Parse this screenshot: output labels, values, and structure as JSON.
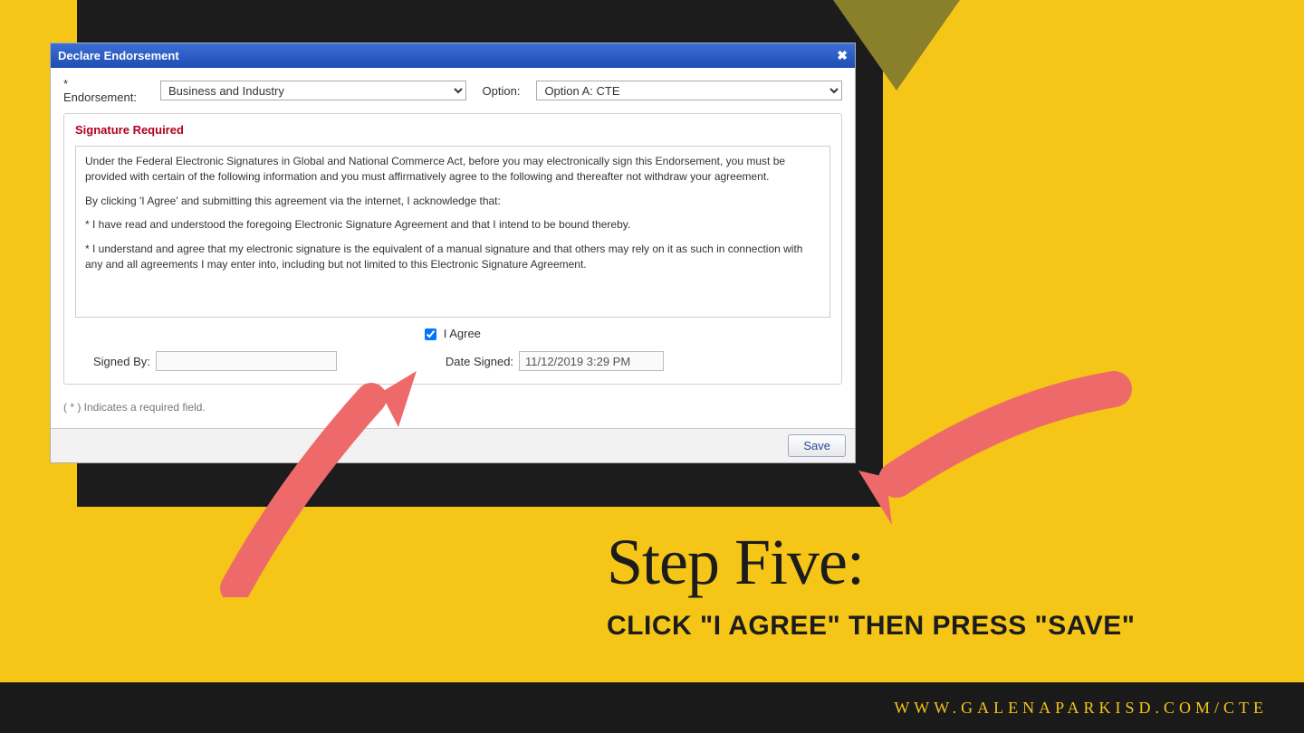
{
  "decor": {
    "triangle_color": "#8a7f2b",
    "arrow_color": "#ee6a6a"
  },
  "dialog": {
    "title": "Declare Endorsement",
    "close_icon": "✖",
    "endorsement_label": "* Endorsement:",
    "endorsement_value": "Business and Industry",
    "option_label": "Option:",
    "option_value": "Option A: CTE",
    "sig_section_title": "Signature Required",
    "agreement": {
      "p1": "Under the Federal Electronic Signatures in Global and National Commerce Act, before you may electronically sign this Endorsement, you must be provided with certain of the following information and you must affirmatively agree to the following and thereafter not withdraw your agreement.",
      "p2": "By clicking 'I Agree' and submitting this agreement via the internet, I acknowledge that:",
      "p3": "* I have read and understood the foregoing Electronic Signature Agreement and that I intend to be bound thereby.",
      "p4": "* I understand and agree that my electronic signature is the equivalent of a manual signature and that others may rely on it as such in connection with any and all agreements I may enter into, including but not limited to this Electronic Signature Agreement."
    },
    "agree_label": "I Agree",
    "signed_by_label": "Signed By:",
    "signed_by_value": "",
    "date_signed_label": "Date Signed:",
    "date_signed_value": "11/12/2019 3:29 PM",
    "required_note": "( * ) Indicates a required field.",
    "save_button": "Save"
  },
  "step": {
    "heading": "Step Five:",
    "sub": "CLICK \"I AGREE\" THEN PRESS \"SAVE\""
  },
  "footer": {
    "url": "WWW.GALENAPARKISD.COM/CTE"
  }
}
